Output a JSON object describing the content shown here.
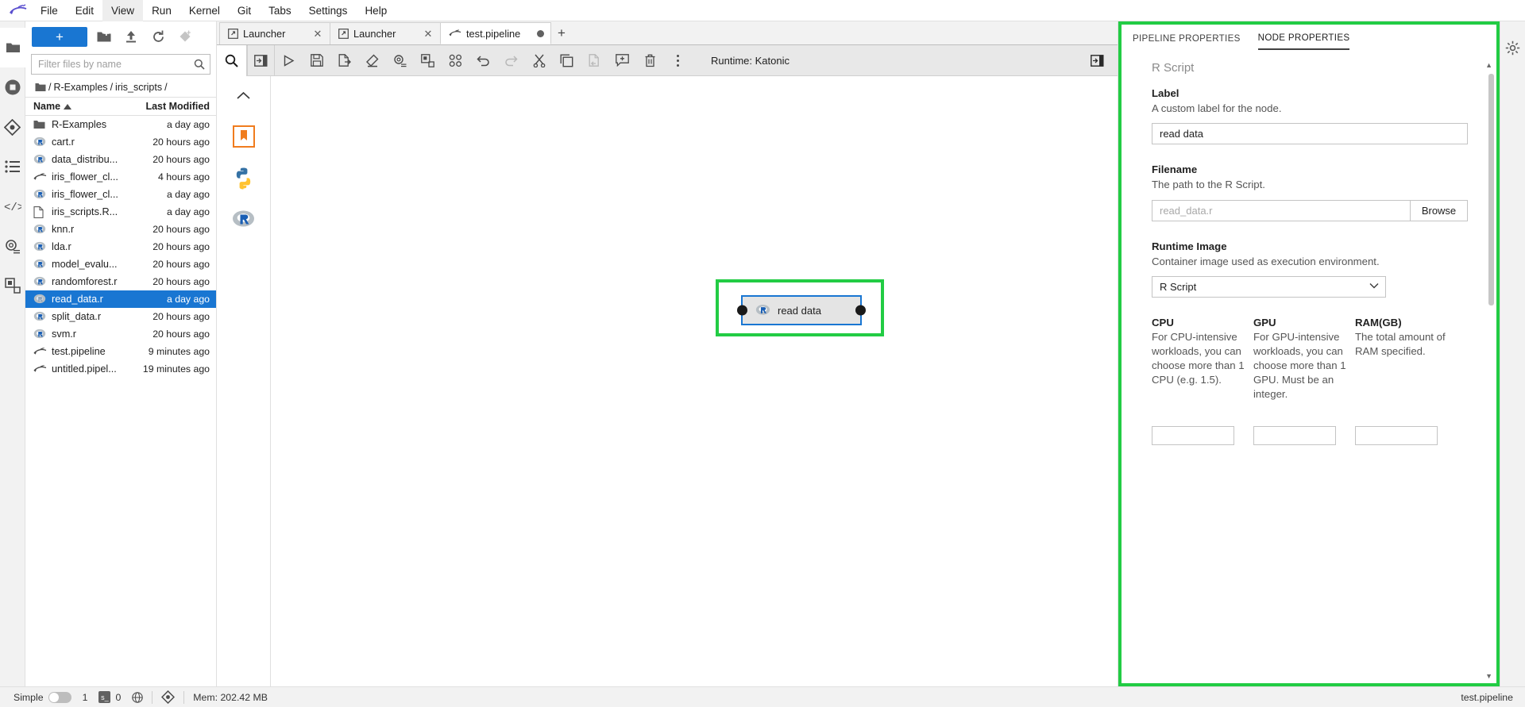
{
  "menubar": {
    "logo_icon": "jupyter-logo-icon",
    "items": [
      {
        "label": "File",
        "active": false
      },
      {
        "label": "Edit",
        "active": false
      },
      {
        "label": "View",
        "active": true
      },
      {
        "label": "Run",
        "active": false
      },
      {
        "label": "Kernel",
        "active": false
      },
      {
        "label": "Git",
        "active": false
      },
      {
        "label": "Tabs",
        "active": false
      },
      {
        "label": "Settings",
        "active": false
      },
      {
        "label": "Help",
        "active": false
      }
    ]
  },
  "left_rail": {
    "items": [
      {
        "icon": "folder-icon",
        "name": "file-browser",
        "selected": true
      },
      {
        "icon": "running-terminals-icon",
        "name": "running-sessions",
        "selected": false
      },
      {
        "icon": "git-icon",
        "name": "git-panel",
        "selected": false
      },
      {
        "icon": "list-icon",
        "name": "table-of-contents",
        "selected": false
      },
      {
        "icon": "code-icon",
        "name": "extension-code",
        "selected": false
      },
      {
        "icon": "settings-gear-icon",
        "name": "property-settings",
        "selected": false
      },
      {
        "icon": "extension-manager-icon",
        "name": "extension-manager",
        "selected": false
      }
    ]
  },
  "filebrowser": {
    "new_button_label": "+",
    "toolbar_icons": [
      "new-folder-icon",
      "upload-icon",
      "refresh-icon",
      "new-git-icon"
    ],
    "filter_placeholder": "Filter files by name",
    "filter_value": "",
    "search_icon": "search-icon",
    "breadcrumb": [
      "/",
      "R-Examples",
      "/",
      "iris_scripts",
      "/"
    ],
    "breadcrumb_root_icon": "folder-icon",
    "columns": {
      "name": "Name",
      "last_modified": "Last Modified",
      "sort_icon": "sort-ascending-icon"
    },
    "files": [
      {
        "name": "R-Examples",
        "modified": "a day ago",
        "icon": "folder-icon",
        "selected": false
      },
      {
        "name": "cart.r",
        "modified": "20 hours ago",
        "icon": "r-file-icon",
        "selected": false
      },
      {
        "name": "data_distribu...",
        "modified": "20 hours ago",
        "icon": "r-file-icon",
        "selected": false
      },
      {
        "name": "iris_flower_cl...",
        "modified": "4 hours ago",
        "icon": "pipeline-file-icon",
        "selected": false
      },
      {
        "name": "iris_flower_cl...",
        "modified": "a day ago",
        "icon": "r-file-icon",
        "selected": false
      },
      {
        "name": "iris_scripts.R...",
        "modified": "a day ago",
        "icon": "generic-file-icon",
        "selected": false
      },
      {
        "name": "knn.r",
        "modified": "20 hours ago",
        "icon": "r-file-icon",
        "selected": false
      },
      {
        "name": "lda.r",
        "modified": "20 hours ago",
        "icon": "r-file-icon",
        "selected": false
      },
      {
        "name": "model_evalu...",
        "modified": "20 hours ago",
        "icon": "r-file-icon",
        "selected": false
      },
      {
        "name": "randomforest.r",
        "modified": "20 hours ago",
        "icon": "r-file-icon",
        "selected": false
      },
      {
        "name": "read_data.r",
        "modified": "a day ago",
        "icon": "r-file-icon",
        "selected": true
      },
      {
        "name": "split_data.r",
        "modified": "20 hours ago",
        "icon": "r-file-icon",
        "selected": false
      },
      {
        "name": "svm.r",
        "modified": "20 hours ago",
        "icon": "r-file-icon",
        "selected": false
      },
      {
        "name": "test.pipeline",
        "modified": "9 minutes ago",
        "icon": "pipeline-file-icon",
        "selected": false
      },
      {
        "name": "untitled.pipel...",
        "modified": "19 minutes ago",
        "icon": "pipeline-file-icon",
        "selected": false
      }
    ]
  },
  "tabs": [
    {
      "label": "Launcher",
      "icon": "launcher-icon",
      "active": false,
      "dirty": false
    },
    {
      "label": "Launcher",
      "icon": "launcher-icon",
      "active": false,
      "dirty": false
    },
    {
      "label": "test.pipeline",
      "icon": "pipeline-file-icon",
      "active": true,
      "dirty": true
    }
  ],
  "tab_add_label": "+",
  "editor_toolbar": {
    "palette_icon": "search-icon",
    "buttons": [
      {
        "icon": "open-panel-icon",
        "name": "toggle-palette-button"
      },
      {
        "icon": "play-icon",
        "name": "run-pipeline-button"
      },
      {
        "icon": "save-icon",
        "name": "save-pipeline-button"
      },
      {
        "icon": "export-icon",
        "name": "export-pipeline-button"
      },
      {
        "icon": "clear-icon",
        "name": "clear-pipeline-button"
      },
      {
        "icon": "settings-gear-icon",
        "name": "pipeline-properties-button"
      },
      {
        "icon": "node-properties-icon",
        "name": "toggle-node-properties-button"
      },
      {
        "icon": "arrange-icon",
        "name": "arrange-layout-button"
      },
      {
        "icon": "undo-icon",
        "name": "undo-button"
      },
      {
        "icon": "redo-icon",
        "name": "redo-button"
      },
      {
        "icon": "cut-icon",
        "name": "cut-button"
      },
      {
        "icon": "copy-icon",
        "name": "copy-button"
      },
      {
        "icon": "paste-icon",
        "name": "paste-button"
      },
      {
        "icon": "add-comment-icon",
        "name": "add-comment-button"
      },
      {
        "icon": "trash-icon",
        "name": "delete-button"
      },
      {
        "icon": "more-vertical-icon",
        "name": "more-options-button"
      }
    ],
    "runtime_label": "Runtime: Katonic",
    "panel_toggle_icon": "open-panel-icon"
  },
  "palette_rail": {
    "collapse_icon": "chevron-up-icon",
    "items": [
      {
        "icon": "bookmark-icon",
        "name": "palette-generic-node"
      },
      {
        "icon": "python-icon",
        "name": "palette-python-node"
      },
      {
        "icon": "r-icon",
        "name": "palette-r-node"
      }
    ]
  },
  "canvas": {
    "node": {
      "label": "read data",
      "icon": "r-icon",
      "input_port": "input-port",
      "output_port": "output-port",
      "selection_color": "#22cc44",
      "border_color": "#1976d2"
    }
  },
  "properties": {
    "tabs": [
      {
        "label": "PIPELINE PROPERTIES",
        "active": false
      },
      {
        "label": "NODE PROPERTIES",
        "active": true
      }
    ],
    "node_type": "R Script",
    "fields": {
      "label": {
        "title": "Label",
        "description": "A custom label for the node.",
        "value": "read data",
        "placeholder": ""
      },
      "filename": {
        "title": "Filename",
        "description": "The path to the R Script.",
        "value": "",
        "placeholder": "read_data.r",
        "browse_label": "Browse"
      },
      "runtime_image": {
        "title": "Runtime Image",
        "description": "Container image used as execution environment.",
        "value": "R Script",
        "chevron_icon": "chevron-down-icon"
      },
      "cpu": {
        "title": "CPU",
        "description": "For CPU-intensive workloads, you can choose more than 1 CPU (e.g. 1.5).",
        "value": ""
      },
      "gpu": {
        "title": "GPU",
        "description": "For GPU-intensive workloads, you can choose more than 1 GPU. Must be an integer.",
        "value": ""
      },
      "ram": {
        "title": "RAM(GB)",
        "description": "The total amount of RAM specified.",
        "value": ""
      }
    }
  },
  "right_rail": {
    "items": [
      {
        "icon": "settings-gear-icon",
        "name": "right-settings-panel"
      }
    ]
  },
  "statusbar": {
    "mode_label": "Simple",
    "mode_enabled": false,
    "terminal_count": "1",
    "kernel_badge": "s_",
    "kernel_count": "0",
    "globe_icon": "globe-icon",
    "git_icon": "git-icon",
    "memory_label": "Mem: 202.42 MB",
    "file_label": "test.pipeline"
  },
  "colors": {
    "accent_blue": "#1976d2",
    "selection_green": "#22cc44",
    "panel_grey": "#f2f2f2"
  }
}
